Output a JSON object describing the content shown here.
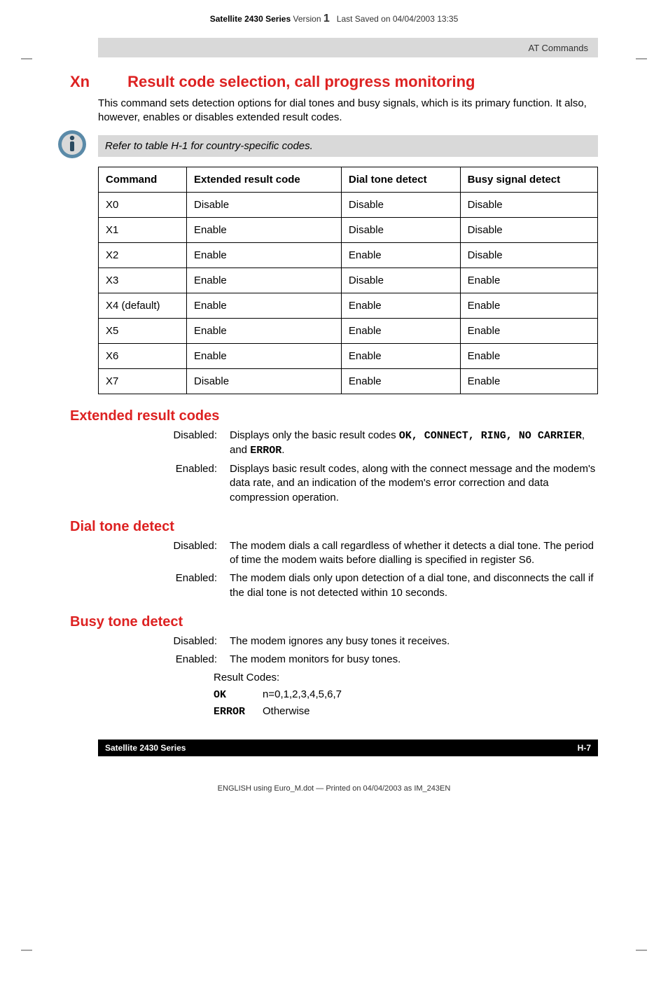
{
  "header": {
    "series": "Satellite 2430 Series",
    "version_label": "Version",
    "version_num": "1",
    "saved": "Last Saved on 04/04/2003 13:35"
  },
  "greybar": {
    "text": "AT Commands"
  },
  "xn": {
    "cmd": "Xn",
    "title": "Result code selection, call progress monitoring",
    "para": "This command sets detection options for dial tones and busy signals, which is its primary function. It also, however, enables or disables extended result codes.",
    "note": "Refer to table H-1 for country-specific codes.",
    "table": {
      "headers": [
        "Command",
        "Extended result code",
        "Dial tone detect",
        "Busy signal detect"
      ],
      "rows": [
        [
          "X0",
          "Disable",
          "Disable",
          "Disable"
        ],
        [
          "X1",
          "Enable",
          "Disable",
          "Disable"
        ],
        [
          "X2",
          "Enable",
          "Enable",
          "Disable"
        ],
        [
          "X3",
          "Enable",
          "Disable",
          "Enable"
        ],
        [
          "X4 (default)",
          "Enable",
          "Enable",
          "Enable"
        ],
        [
          "X5",
          "Enable",
          "Enable",
          "Enable"
        ],
        [
          "X6",
          "Enable",
          "Enable",
          "Enable"
        ],
        [
          "X7",
          "Disable",
          "Enable",
          "Enable"
        ]
      ]
    }
  },
  "ext_codes": {
    "title": "Extended result codes",
    "disabled_pre": "Displays only the basic result codes ",
    "disabled_codes": "OK, CONNECT, RING, NO CARRIER",
    "disabled_mid": ", and ",
    "disabled_last": "ERROR",
    "disabled_end": ".",
    "enabled": "Displays basic result codes, along with the connect message and the modem's data rate, and an indication of the modem's error correction and data compression operation."
  },
  "dial": {
    "title": "Dial tone detect",
    "disabled": "The modem dials a call regardless of whether it detects a dial tone. The period of time the modem waits before dialling is specified in register S6.",
    "enabled": "The modem dials only upon detection of a dial tone, and disconnects the call if the dial tone is not detected within 10 seconds."
  },
  "busy": {
    "title": "Busy tone detect",
    "disabled": "The modem ignores any busy tones it receives.",
    "enabled": "The modem monitors for busy tones.",
    "rc_label": "Result Codes:",
    "ok_code": "OK",
    "ok_val": "n=0,1,2,3,4,5,6,7",
    "err_code": "ERROR",
    "err_val": "Otherwise"
  },
  "labels": {
    "disabled": "Disabled:",
    "enabled": "Enabled:"
  },
  "footer": {
    "series": "Satellite 2430 Series",
    "page": "H-7",
    "print": "ENGLISH using  Euro_M.dot — Printed on 04/04/2003 as IM_243EN"
  }
}
